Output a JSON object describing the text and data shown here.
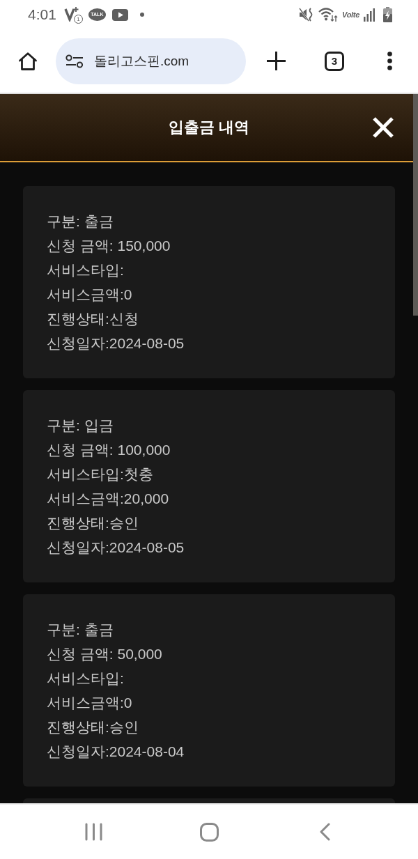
{
  "status_bar": {
    "time": "4:01",
    "notification_count": "1",
    "chat_badge": "TALK",
    "network_label": "Volte"
  },
  "browser": {
    "url": "돌리고스핀.com",
    "tab_count": "3"
  },
  "modal": {
    "title": "입출금 내역"
  },
  "history": {
    "records": [
      {
        "lines": [
          "구분: 출금",
          "신청 금액: 150,000",
          "서비스타입:",
          "서비스금액:0",
          "진행상태:신청",
          "신청일자:2024-08-05"
        ]
      },
      {
        "lines": [
          "구분: 입금",
          "신청 금액: 100,000",
          "서비스타입:첫충",
          "서비스금액:20,000",
          "진행상태:승인",
          "신청일자:2024-08-05"
        ]
      },
      {
        "lines": [
          "구분: 출금",
          "신청 금액: 50,000",
          "서비스타입:",
          "서비스금액:0",
          "진행상태:승인",
          "신청일자:2024-08-04"
        ]
      }
    ],
    "more_below": true
  }
}
